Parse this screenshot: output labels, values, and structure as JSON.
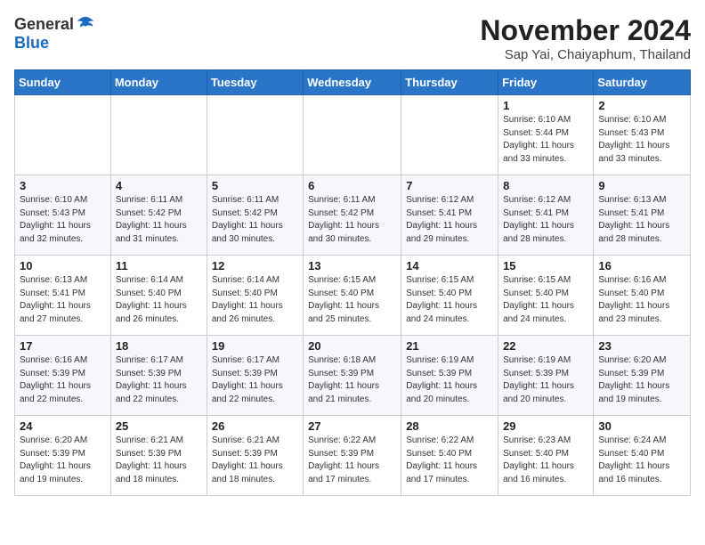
{
  "logo": {
    "general": "General",
    "blue": "Blue"
  },
  "title": "November 2024",
  "subtitle": "Sap Yai, Chaiyaphum, Thailand",
  "weekdays": [
    "Sunday",
    "Monday",
    "Tuesday",
    "Wednesday",
    "Thursday",
    "Friday",
    "Saturday"
  ],
  "weeks": [
    [
      {
        "day": "",
        "info": ""
      },
      {
        "day": "",
        "info": ""
      },
      {
        "day": "",
        "info": ""
      },
      {
        "day": "",
        "info": ""
      },
      {
        "day": "",
        "info": ""
      },
      {
        "day": "1",
        "info": "Sunrise: 6:10 AM\nSunset: 5:44 PM\nDaylight: 11 hours\nand 33 minutes."
      },
      {
        "day": "2",
        "info": "Sunrise: 6:10 AM\nSunset: 5:43 PM\nDaylight: 11 hours\nand 33 minutes."
      }
    ],
    [
      {
        "day": "3",
        "info": "Sunrise: 6:10 AM\nSunset: 5:43 PM\nDaylight: 11 hours\nand 32 minutes."
      },
      {
        "day": "4",
        "info": "Sunrise: 6:11 AM\nSunset: 5:42 PM\nDaylight: 11 hours\nand 31 minutes."
      },
      {
        "day": "5",
        "info": "Sunrise: 6:11 AM\nSunset: 5:42 PM\nDaylight: 11 hours\nand 30 minutes."
      },
      {
        "day": "6",
        "info": "Sunrise: 6:11 AM\nSunset: 5:42 PM\nDaylight: 11 hours\nand 30 minutes."
      },
      {
        "day": "7",
        "info": "Sunrise: 6:12 AM\nSunset: 5:41 PM\nDaylight: 11 hours\nand 29 minutes."
      },
      {
        "day": "8",
        "info": "Sunrise: 6:12 AM\nSunset: 5:41 PM\nDaylight: 11 hours\nand 28 minutes."
      },
      {
        "day": "9",
        "info": "Sunrise: 6:13 AM\nSunset: 5:41 PM\nDaylight: 11 hours\nand 28 minutes."
      }
    ],
    [
      {
        "day": "10",
        "info": "Sunrise: 6:13 AM\nSunset: 5:41 PM\nDaylight: 11 hours\nand 27 minutes."
      },
      {
        "day": "11",
        "info": "Sunrise: 6:14 AM\nSunset: 5:40 PM\nDaylight: 11 hours\nand 26 minutes."
      },
      {
        "day": "12",
        "info": "Sunrise: 6:14 AM\nSunset: 5:40 PM\nDaylight: 11 hours\nand 26 minutes."
      },
      {
        "day": "13",
        "info": "Sunrise: 6:15 AM\nSunset: 5:40 PM\nDaylight: 11 hours\nand 25 minutes."
      },
      {
        "day": "14",
        "info": "Sunrise: 6:15 AM\nSunset: 5:40 PM\nDaylight: 11 hours\nand 24 minutes."
      },
      {
        "day": "15",
        "info": "Sunrise: 6:15 AM\nSunset: 5:40 PM\nDaylight: 11 hours\nand 24 minutes."
      },
      {
        "day": "16",
        "info": "Sunrise: 6:16 AM\nSunset: 5:40 PM\nDaylight: 11 hours\nand 23 minutes."
      }
    ],
    [
      {
        "day": "17",
        "info": "Sunrise: 6:16 AM\nSunset: 5:39 PM\nDaylight: 11 hours\nand 22 minutes."
      },
      {
        "day": "18",
        "info": "Sunrise: 6:17 AM\nSunset: 5:39 PM\nDaylight: 11 hours\nand 22 minutes."
      },
      {
        "day": "19",
        "info": "Sunrise: 6:17 AM\nSunset: 5:39 PM\nDaylight: 11 hours\nand 22 minutes."
      },
      {
        "day": "20",
        "info": "Sunrise: 6:18 AM\nSunset: 5:39 PM\nDaylight: 11 hours\nand 21 minutes."
      },
      {
        "day": "21",
        "info": "Sunrise: 6:19 AM\nSunset: 5:39 PM\nDaylight: 11 hours\nand 20 minutes."
      },
      {
        "day": "22",
        "info": "Sunrise: 6:19 AM\nSunset: 5:39 PM\nDaylight: 11 hours\nand 20 minutes."
      },
      {
        "day": "23",
        "info": "Sunrise: 6:20 AM\nSunset: 5:39 PM\nDaylight: 11 hours\nand 19 minutes."
      }
    ],
    [
      {
        "day": "24",
        "info": "Sunrise: 6:20 AM\nSunset: 5:39 PM\nDaylight: 11 hours\nand 19 minutes."
      },
      {
        "day": "25",
        "info": "Sunrise: 6:21 AM\nSunset: 5:39 PM\nDaylight: 11 hours\nand 18 minutes."
      },
      {
        "day": "26",
        "info": "Sunrise: 6:21 AM\nSunset: 5:39 PM\nDaylight: 11 hours\nand 18 minutes."
      },
      {
        "day": "27",
        "info": "Sunrise: 6:22 AM\nSunset: 5:39 PM\nDaylight: 11 hours\nand 17 minutes."
      },
      {
        "day": "28",
        "info": "Sunrise: 6:22 AM\nSunset: 5:40 PM\nDaylight: 11 hours\nand 17 minutes."
      },
      {
        "day": "29",
        "info": "Sunrise: 6:23 AM\nSunset: 5:40 PM\nDaylight: 11 hours\nand 16 minutes."
      },
      {
        "day": "30",
        "info": "Sunrise: 6:24 AM\nSunset: 5:40 PM\nDaylight: 11 hours\nand 16 minutes."
      }
    ]
  ]
}
